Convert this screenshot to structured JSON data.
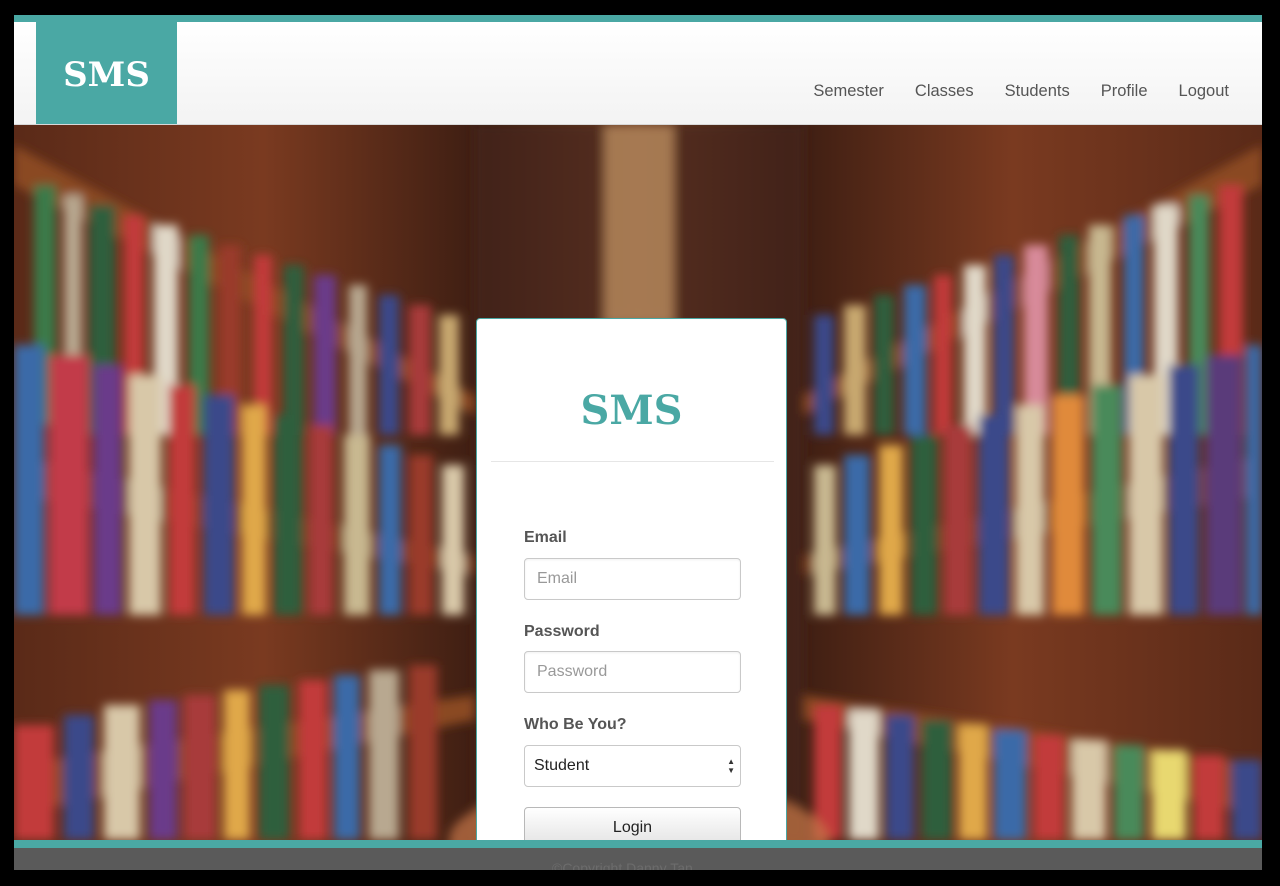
{
  "brand": {
    "logo_text": "SMS",
    "accent_color": "#4aa8a4"
  },
  "nav": {
    "items": [
      {
        "label": "Semester"
      },
      {
        "label": "Classes"
      },
      {
        "label": "Students"
      },
      {
        "label": "Profile"
      },
      {
        "label": "Logout"
      }
    ]
  },
  "login": {
    "title": "SMS",
    "email_label": "Email",
    "email_placeholder": "Email",
    "email_value": "",
    "password_label": "Password",
    "password_placeholder": "Password",
    "password_value": "",
    "role_label": "Who Be You?",
    "role_selected": "Student",
    "submit_label": "Login"
  },
  "footer": {
    "text": "©Copyright Danny Tan"
  }
}
